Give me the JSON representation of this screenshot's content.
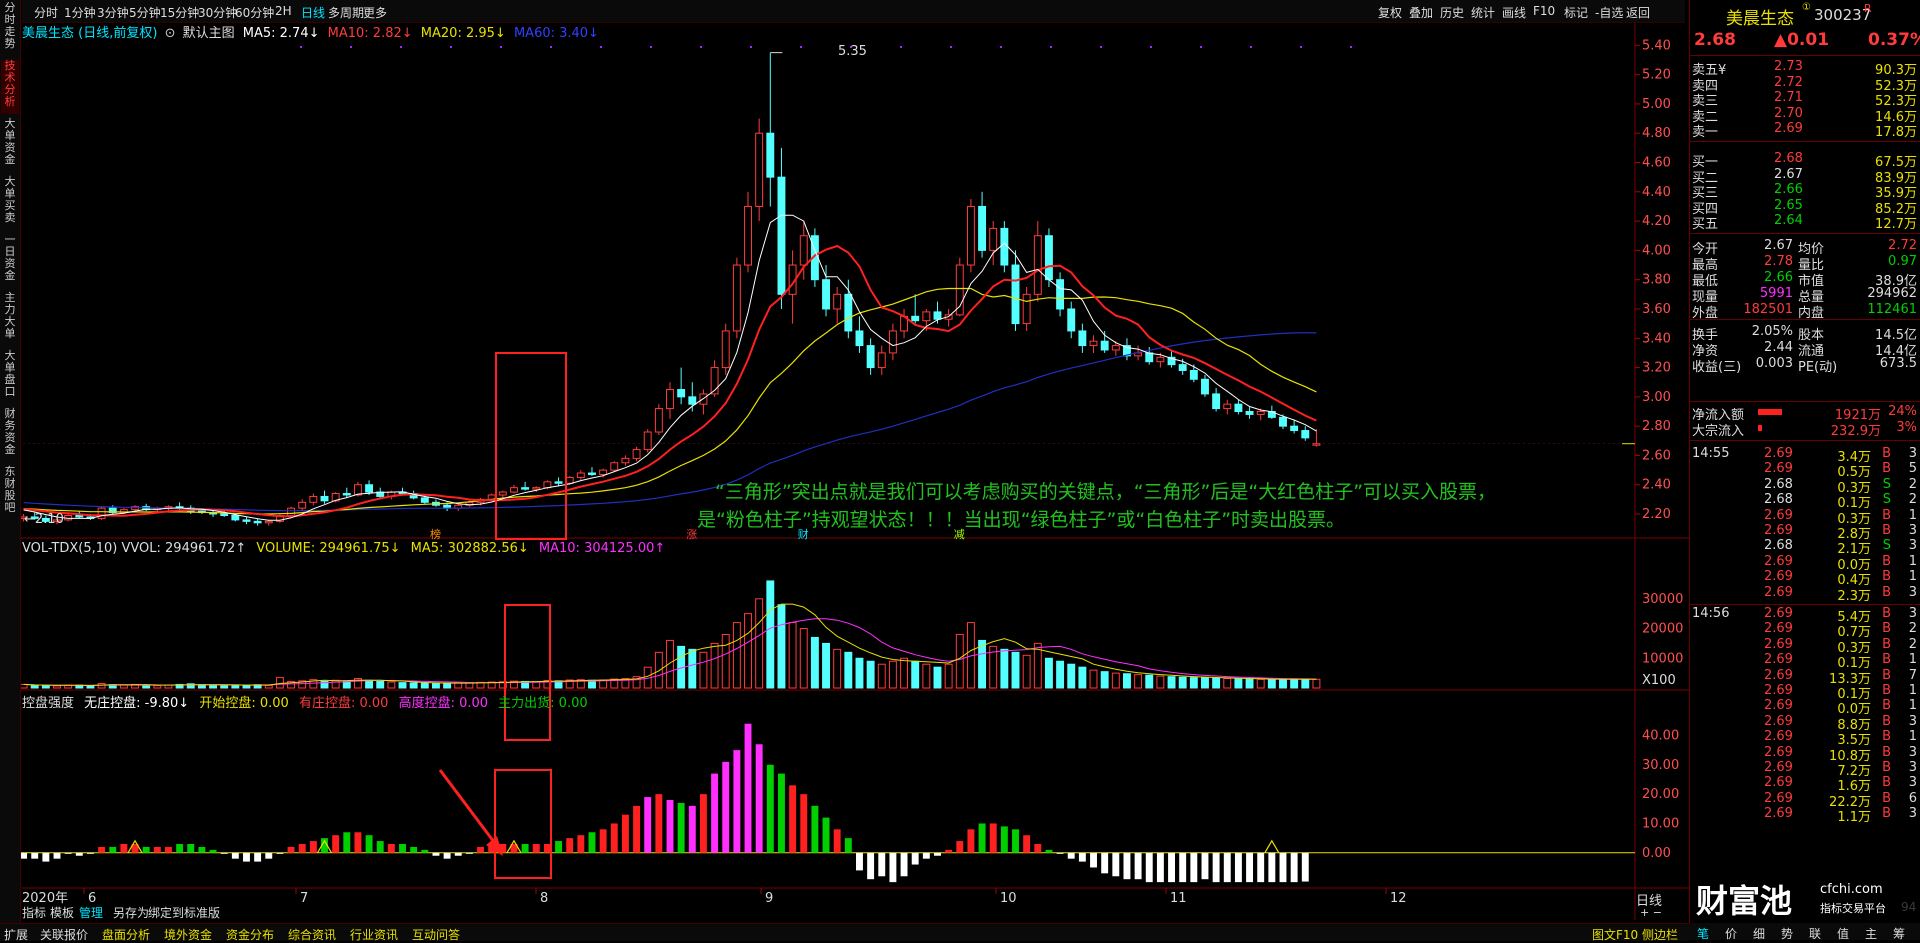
{
  "top_tabs": [
    "分时",
    "1分钟",
    "3分钟",
    "5分钟",
    "15分钟",
    "30分钟",
    "60分钟",
    "2H",
    "日线",
    "多周期",
    "更多"
  ],
  "top_active": 8,
  "top_right_buttons": [
    "复权",
    "叠加",
    "历史",
    "统计",
    "画线",
    "F10",
    "标记",
    "-自选",
    "返回"
  ],
  "left_tabs": [
    "分时走势",
    "技术分析",
    "大单资金",
    "大单买卖",
    "一日资金",
    "主力大单",
    "大单盘口",
    "财务资金",
    "东财股吧"
  ],
  "left_active": 1,
  "stock": {
    "name": "美晨生态",
    "code": "300237",
    "suffix": "R",
    "price": "2.68",
    "change": "▲0.01",
    "pct": "0.37%"
  },
  "main_legend": {
    "title": "美晨生态 (日线,前复权)",
    "sub": "默认主图",
    "ma5": "MA5: 2.74↓",
    "ma10": "MA10: 2.82↓",
    "ma20": "MA20: 2.95↓",
    "ma60": "MA60: 3.40↓"
  },
  "vol_legend": {
    "a": "VOL-TDX(5,10) VVOL: 294961.72↑",
    "b": "VOLUME: 294961.75↓",
    "c": "MA5: 302882.56↓",
    "d": "MA10: 304125.00↑"
  },
  "ind_legend": {
    "a": "控盘强度",
    "b": "无庄控盘: -9.80↓",
    "c": "开始控盘: 0.00",
    "d": "有庄控盘: 0.00",
    "e": "高度控盘: 0.00",
    "f": "主力出货: 0.00"
  },
  "price_axis": [
    "5.40",
    "5.20",
    "5.00",
    "4.80",
    "4.60",
    "4.40",
    "4.20",
    "4.00",
    "3.80",
    "3.60",
    "3.40",
    "3.20",
    "3.00",
    "2.80",
    "2.60",
    "2.40",
    "2.20"
  ],
  "vol_axis": [
    "30000",
    "20000",
    "10000",
    "X100"
  ],
  "ind_axis": [
    "40.00",
    "30.00",
    "20.00",
    "10.00",
    "0.00"
  ],
  "month_axis": [
    "2020年",
    "6",
    "7",
    "8",
    "9",
    "10",
    "11",
    "12"
  ],
  "period_label": "日线",
  "high_label": "5.35",
  "low_label": "2.10",
  "annotation_line1": "“三角形”突出点就是我们可以考虑购买的关键点，“三角形”后是“大红色柱子”可以买入股票，",
  "annotation_line2": "是“粉色柱子”持观望状态！！！当出现“绿色柱子”或“白色柱子”时卖出股票。",
  "event_marks": [
    "榜",
    "涨",
    "财",
    "减"
  ],
  "tools": [
    "指标",
    "模板",
    "管理",
    "另存为",
    "绑定到",
    "标准版"
  ],
  "bottom_tabs": [
    "扩展",
    "关联报价",
    "盘面分析",
    "境外资金",
    "资金分布",
    "综合资讯",
    "行业资讯",
    "互动问答"
  ],
  "bottom_right": "图文F10 侧边栏",
  "right_bottom_tabs": [
    "笔",
    "价",
    "细",
    "势",
    "联",
    "值",
    "主",
    "筹"
  ],
  "order_book": {
    "sell": [
      [
        "卖五",
        "2.73",
        "90.3万"
      ],
      [
        "卖四",
        "2.72",
        "52.3万"
      ],
      [
        "卖三",
        "2.71",
        "52.3万"
      ],
      [
        "卖二",
        "2.70",
        "14.6万"
      ],
      [
        "卖一",
        "2.69",
        "17.8万"
      ]
    ],
    "buy": [
      [
        "买一",
        "2.68",
        "67.5万"
      ],
      [
        "买二",
        "2.67",
        "83.9万"
      ],
      [
        "买三",
        "2.66",
        "35.9万"
      ],
      [
        "买四",
        "2.65",
        "85.2万"
      ],
      [
        "买五",
        "2.64",
        "12.7万"
      ]
    ],
    "currency": "¥"
  },
  "stats": [
    [
      "今开",
      "2.67",
      "均价",
      "2.72"
    ],
    [
      "最高",
      "2.78",
      "量比",
      "0.97"
    ],
    [
      "最低",
      "2.66",
      "市值",
      "38.9亿"
    ],
    [
      "现量",
      "5991",
      "总量",
      "294962"
    ],
    [
      "外盘",
      "182501",
      "内盘",
      "112461"
    ],
    [
      "换手",
      "2.05%",
      "股本",
      "14.5亿"
    ],
    [
      "净资",
      "2.44",
      "流通",
      "14.4亿"
    ],
    [
      "收益(三)",
      "0.003",
      "PE(动)",
      "673.5"
    ]
  ],
  "flows": [
    [
      "净流入额",
      "1921万",
      "24%"
    ],
    [
      "大宗流入",
      "232.9万",
      "3%"
    ]
  ],
  "ticks": [
    [
      "14:55",
      "2.69",
      "3.4万",
      "B",
      "3"
    ],
    [
      "",
      "2.69",
      "0.5万",
      "B",
      "5"
    ],
    [
      "",
      "2.68",
      "0.3万",
      "S",
      "2"
    ],
    [
      "",
      "2.68",
      "0.1万",
      "S",
      "2"
    ],
    [
      "",
      "2.69",
      "0.3万",
      "B",
      "1"
    ],
    [
      "",
      "2.69",
      "2.8万",
      "B",
      "3"
    ],
    [
      "",
      "2.68",
      "2.1万",
      "S",
      "3"
    ],
    [
      "",
      "2.69",
      "0.0万",
      "B",
      "1"
    ],
    [
      "",
      "2.69",
      "0.4万",
      "B",
      "1"
    ],
    [
      "",
      "2.69",
      "2.3万",
      "B",
      "3"
    ],
    [
      "14:56",
      "2.69",
      "5.4万",
      "B",
      "3"
    ],
    [
      "",
      "2.69",
      "0.7万",
      "B",
      "2"
    ],
    [
      "",
      "2.69",
      "0.3万",
      "B",
      "2"
    ],
    [
      "",
      "2.69",
      "0.1万",
      "B",
      "1"
    ],
    [
      "",
      "2.69",
      "13.3万",
      "B",
      "7"
    ],
    [
      "",
      "2.69",
      "0.1万",
      "B",
      "1"
    ],
    [
      "",
      "2.69",
      "0.0万",
      "B",
      "1"
    ],
    [
      "",
      "2.69",
      "8.8万",
      "B",
      "3"
    ],
    [
      "",
      "2.69",
      "3.5万",
      "B",
      "1"
    ],
    [
      "",
      "2.69",
      "10.8万",
      "B",
      "3"
    ],
    [
      "",
      "2.69",
      "7.2万",
      "B",
      "3"
    ],
    [
      "",
      "2.69",
      "1.6万",
      "B",
      "3"
    ],
    [
      "",
      "2.69",
      "22.2万",
      "B",
      "6"
    ],
    [
      "",
      "2.69",
      "1.1万",
      "B",
      "3"
    ]
  ],
  "watermark": {
    "big": "财富池",
    "site": "cfchi.com",
    "sub": "指标交易平台"
  },
  "scroll_label": "94",
  "colors": {
    "red": "#ff3b3b",
    "cyan": "#54ffff",
    "green": "#00d000",
    "magenta": "#ff30ff",
    "yellow": "#e8e000",
    "blue": "#2030c0",
    "white": "#ffffff",
    "box": "#ff2020"
  },
  "chart_data": {
    "type": "candlestick",
    "price_range": [
      2.05,
      5.45
    ],
    "volume_range_x100": [
      0,
      38000
    ],
    "indicator_range": [
      -12,
      48
    ],
    "candles_ohlc": [
      [
        2.17,
        2.2,
        2.15,
        2.18
      ],
      [
        2.18,
        2.21,
        2.16,
        2.17
      ],
      [
        2.17,
        2.19,
        2.14,
        2.15
      ],
      [
        2.15,
        2.18,
        2.13,
        2.16
      ],
      [
        2.16,
        2.2,
        2.15,
        2.19
      ],
      [
        2.19,
        2.22,
        2.17,
        2.18
      ],
      [
        2.18,
        2.2,
        2.16,
        2.17
      ],
      [
        2.17,
        2.25,
        2.16,
        2.24
      ],
      [
        2.24,
        2.26,
        2.2,
        2.21
      ],
      [
        2.21,
        2.24,
        2.2,
        2.23
      ],
      [
        2.23,
        2.26,
        2.21,
        2.25
      ],
      [
        2.25,
        2.27,
        2.22,
        2.23
      ],
      [
        2.23,
        2.25,
        2.21,
        2.24
      ],
      [
        2.24,
        2.26,
        2.22,
        2.25
      ],
      [
        2.25,
        2.28,
        2.23,
        2.24
      ],
      [
        2.24,
        2.26,
        2.2,
        2.22
      ],
      [
        2.22,
        2.24,
        2.2,
        2.21
      ],
      [
        2.21,
        2.23,
        2.18,
        2.2
      ],
      [
        2.2,
        2.22,
        2.18,
        2.19
      ],
      [
        2.19,
        2.2,
        2.15,
        2.16
      ],
      [
        2.16,
        2.18,
        2.13,
        2.15
      ],
      [
        2.15,
        2.17,
        2.12,
        2.14
      ],
      [
        2.14,
        2.16,
        2.12,
        2.15
      ],
      [
        2.15,
        2.2,
        2.14,
        2.19
      ],
      [
        2.19,
        2.25,
        2.18,
        2.24
      ],
      [
        2.24,
        2.3,
        2.22,
        2.28
      ],
      [
        2.28,
        2.34,
        2.26,
        2.32
      ],
      [
        2.32,
        2.36,
        2.27,
        2.29
      ],
      [
        2.29,
        2.35,
        2.28,
        2.34
      ],
      [
        2.34,
        2.38,
        2.31,
        2.33
      ],
      [
        2.33,
        2.42,
        2.32,
        2.4
      ],
      [
        2.4,
        2.43,
        2.33,
        2.35
      ],
      [
        2.35,
        2.38,
        2.3,
        2.32
      ],
      [
        2.32,
        2.36,
        2.3,
        2.35
      ],
      [
        2.35,
        2.38,
        2.33,
        2.34
      ],
      [
        2.34,
        2.36,
        2.3,
        2.31
      ],
      [
        2.31,
        2.33,
        2.27,
        2.28
      ],
      [
        2.28,
        2.3,
        2.25,
        2.26
      ],
      [
        2.26,
        2.28,
        2.22,
        2.24
      ],
      [
        2.24,
        2.27,
        2.22,
        2.26
      ],
      [
        2.26,
        2.3,
        2.25,
        2.28
      ],
      [
        2.28,
        2.31,
        2.26,
        2.3
      ],
      [
        2.3,
        2.34,
        2.29,
        2.33
      ],
      [
        2.33,
        2.36,
        2.31,
        2.35
      ],
      [
        2.35,
        2.4,
        2.34,
        2.38
      ],
      [
        2.38,
        2.42,
        2.36,
        2.37
      ],
      [
        2.37,
        2.39,
        2.35,
        2.38
      ],
      [
        2.38,
        2.43,
        2.37,
        2.42
      ],
      [
        2.42,
        2.45,
        2.39,
        2.41
      ],
      [
        2.41,
        2.46,
        2.4,
        2.45
      ],
      [
        2.45,
        2.5,
        2.43,
        2.48
      ],
      [
        2.48,
        2.52,
        2.46,
        2.47
      ],
      [
        2.47,
        2.51,
        2.45,
        2.5
      ],
      [
        2.5,
        2.56,
        2.49,
        2.55
      ],
      [
        2.55,
        2.6,
        2.53,
        2.58
      ],
      [
        2.58,
        2.66,
        2.56,
        2.64
      ],
      [
        2.64,
        2.78,
        2.62,
        2.76
      ],
      [
        2.76,
        2.95,
        2.74,
        2.92
      ],
      [
        2.92,
        3.1,
        2.85,
        3.05
      ],
      [
        3.05,
        3.2,
        2.95,
        3.0
      ],
      [
        3.0,
        3.1,
        2.9,
        2.95
      ],
      [
        2.95,
        3.05,
        2.88,
        3.02
      ],
      [
        3.02,
        3.25,
        3.0,
        3.2
      ],
      [
        3.2,
        3.5,
        3.15,
        3.45
      ],
      [
        3.45,
        3.95,
        3.4,
        3.9
      ],
      [
        3.9,
        4.4,
        3.85,
        4.3
      ],
      [
        4.3,
        4.9,
        4.2,
        4.8
      ],
      [
        4.8,
        5.35,
        4.3,
        4.5
      ],
      [
        4.5,
        4.7,
        3.6,
        3.7
      ],
      [
        3.7,
        4.0,
        3.5,
        3.9
      ],
      [
        3.9,
        4.2,
        3.8,
        4.1
      ],
      [
        4.1,
        4.15,
        3.75,
        3.8
      ],
      [
        3.8,
        3.9,
        3.55,
        3.6
      ],
      [
        3.6,
        3.75,
        3.5,
        3.7
      ],
      [
        3.7,
        3.8,
        3.4,
        3.45
      ],
      [
        3.45,
        3.55,
        3.3,
        3.35
      ],
      [
        3.35,
        3.4,
        3.15,
        3.2
      ],
      [
        3.2,
        3.35,
        3.15,
        3.3
      ],
      [
        3.3,
        3.5,
        3.25,
        3.45
      ],
      [
        3.45,
        3.6,
        3.4,
        3.55
      ],
      [
        3.55,
        3.7,
        3.5,
        3.52
      ],
      [
        3.52,
        3.6,
        3.45,
        3.58
      ],
      [
        3.58,
        3.65,
        3.5,
        3.53
      ],
      [
        3.53,
        3.6,
        3.48,
        3.56
      ],
      [
        3.56,
        3.95,
        3.55,
        3.9
      ],
      [
        3.9,
        4.35,
        3.85,
        4.3
      ],
      [
        4.3,
        4.4,
        3.95,
        4.0
      ],
      [
        4.0,
        4.2,
        3.9,
        4.15
      ],
      [
        4.15,
        4.2,
        3.85,
        3.9
      ],
      [
        3.9,
        4.0,
        3.45,
        3.5
      ],
      [
        3.5,
        3.75,
        3.45,
        3.7
      ],
      [
        3.7,
        4.2,
        3.65,
        4.1
      ],
      [
        4.1,
        4.15,
        3.75,
        3.8
      ],
      [
        3.8,
        3.85,
        3.55,
        3.6
      ],
      [
        3.6,
        3.65,
        3.4,
        3.45
      ],
      [
        3.45,
        3.5,
        3.3,
        3.35
      ],
      [
        3.35,
        3.42,
        3.3,
        3.38
      ],
      [
        3.38,
        3.45,
        3.3,
        3.32
      ],
      [
        3.32,
        3.38,
        3.28,
        3.35
      ],
      [
        3.35,
        3.4,
        3.25,
        3.28
      ],
      [
        3.28,
        3.35,
        3.25,
        3.3
      ],
      [
        3.3,
        3.34,
        3.22,
        3.24
      ],
      [
        3.24,
        3.3,
        3.2,
        3.27
      ],
      [
        3.27,
        3.32,
        3.2,
        3.22
      ],
      [
        3.22,
        3.26,
        3.15,
        3.18
      ],
      [
        3.18,
        3.22,
        3.1,
        3.12
      ],
      [
        3.12,
        3.15,
        3.0,
        3.02
      ],
      [
        3.02,
        3.06,
        2.9,
        2.92
      ],
      [
        2.92,
        2.98,
        2.88,
        2.95
      ],
      [
        2.95,
        2.98,
        2.88,
        2.9
      ],
      [
        2.9,
        2.93,
        2.85,
        2.88
      ],
      [
        2.88,
        2.92,
        2.84,
        2.9
      ],
      [
        2.9,
        2.94,
        2.85,
        2.86
      ],
      [
        2.86,
        2.88,
        2.78,
        2.8
      ],
      [
        2.8,
        2.84,
        2.75,
        2.77
      ],
      [
        2.77,
        2.8,
        2.7,
        2.72
      ],
      [
        2.67,
        2.78,
        2.66,
        2.68
      ]
    ],
    "volume_x100": [
      1200,
      900,
      800,
      700,
      900,
      1000,
      800,
      1500,
      1100,
      1000,
      1200,
      900,
      800,
      1000,
      1200,
      1400,
      1100,
      900,
      800,
      1000,
      1000,
      1100,
      900,
      3500,
      2200,
      2400,
      2800,
      2200,
      2600,
      2400,
      3200,
      2600,
      2200,
      2000,
      1800,
      1700,
      1600,
      1500,
      1600,
      1800,
      1700,
      1900,
      2000,
      2100,
      2300,
      2200,
      2100,
      2500,
      2400,
      2700,
      2800,
      2600,
      2700,
      3000,
      3200,
      3800,
      7000,
      12000,
      16000,
      14000,
      13000,
      12000,
      15000,
      18000,
      22000,
      25000,
      30000,
      36000,
      28000,
      22000,
      20000,
      17000,
      15000,
      13000,
      12000,
      10000,
      9000,
      8000,
      9000,
      10000,
      9000,
      8000,
      7000,
      8000,
      18000,
      22000,
      16000,
      14000,
      13000,
      12000,
      11000,
      15000,
      10000,
      9000,
      8000,
      7000,
      6000,
      5500,
      5000,
      4800,
      4500,
      4300,
      4000,
      3800,
      3600,
      3500,
      3400,
      3300,
      3200,
      3100,
      3000,
      2900,
      2800,
      2900,
      3000,
      2950,
      2949
    ],
    "indicator": [
      -2,
      -2,
      -3,
      -2,
      0,
      -1,
      0,
      2,
      2,
      3,
      3,
      2,
      2,
      2,
      3,
      3,
      2,
      1,
      0,
      -2,
      -3,
      -3,
      -2,
      0,
      2,
      3,
      4,
      5,
      6,
      7,
      7,
      6,
      4,
      3,
      3,
      2,
      1,
      -1,
      -2,
      -1,
      0,
      2,
      3,
      3,
      3,
      3,
      3,
      3,
      4,
      5,
      6,
      7,
      8,
      10,
      13,
      16,
      19,
      20,
      18,
      17,
      16,
      20,
      27,
      31,
      35,
      44,
      37,
      30,
      27,
      23,
      20,
      16,
      12,
      8,
      5,
      -6,
      -9,
      -8,
      -10,
      -8,
      -4,
      -2,
      -1,
      1,
      4,
      8,
      10,
      10,
      9,
      8,
      6,
      3,
      1,
      0,
      -2,
      -3,
      -5,
      -7,
      -8,
      -9,
      -9,
      -10,
      -10,
      -10,
      -10,
      -10,
      -9,
      -10,
      -10,
      -10,
      -10,
      -10,
      -10,
      -10,
      -10,
      -9.8
    ],
    "ma_lines": [
      "MA5",
      "MA10",
      "MA20",
      "MA60"
    ]
  }
}
